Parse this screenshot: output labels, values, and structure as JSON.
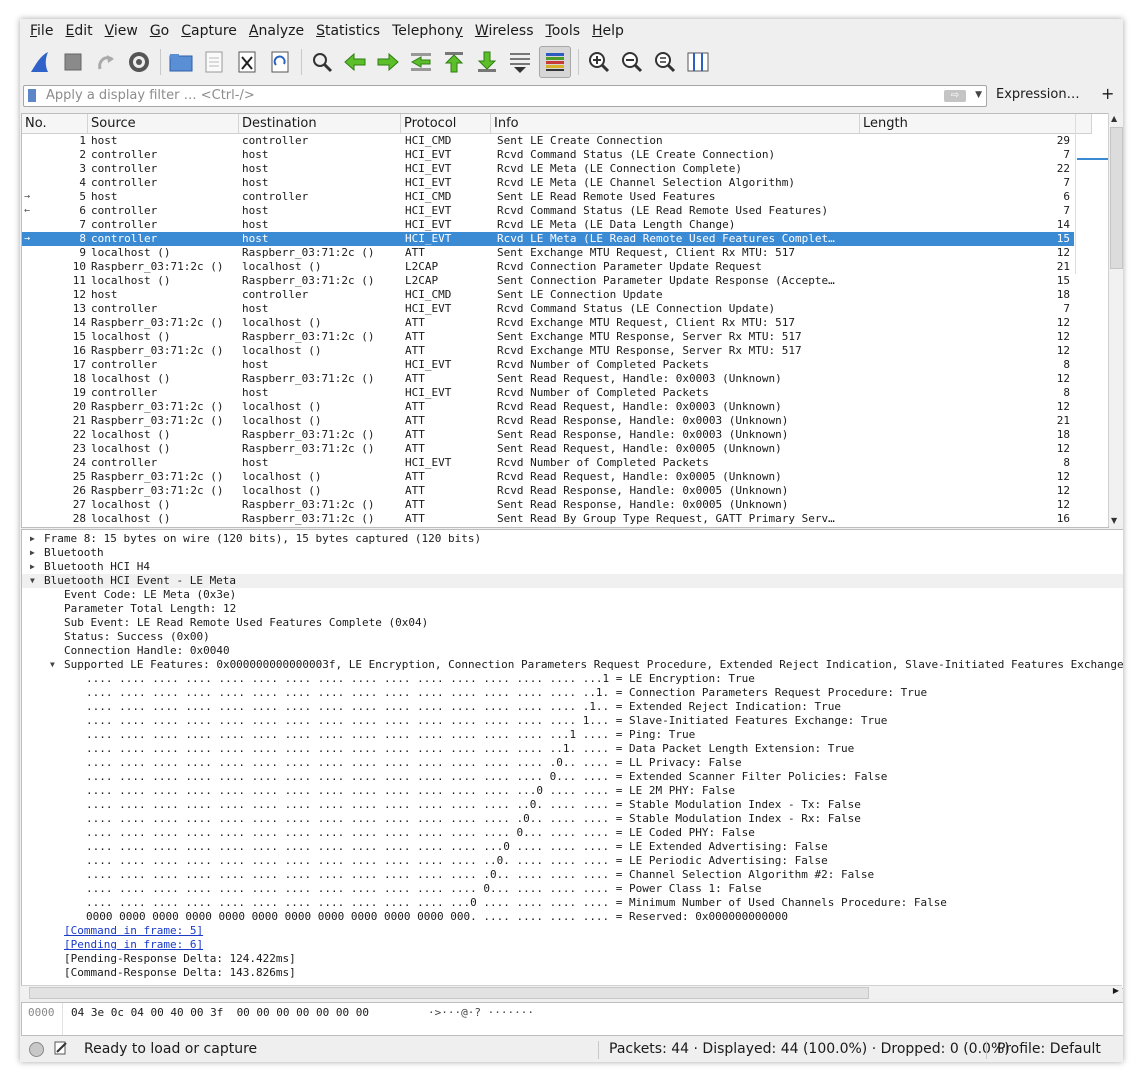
{
  "menu": [
    {
      "u": "F",
      "rest": "ile"
    },
    {
      "u": "E",
      "rest": "dit"
    },
    {
      "u": "V",
      "rest": "iew"
    },
    {
      "u": "G",
      "rest": "o"
    },
    {
      "u": "C",
      "rest": "apture"
    },
    {
      "u": "A",
      "rest": "nalyze"
    },
    {
      "u": "S",
      "rest": "tatistics"
    },
    {
      "u": "",
      "rest": "Telephony",
      "pre": "Telephon",
      "post": "y"
    },
    {
      "u": "W",
      "rest": "ireless"
    },
    {
      "u": "T",
      "rest": "ools"
    },
    {
      "u": "H",
      "rest": "elp"
    }
  ],
  "toolbar_icons": [
    "shark-fin-icon",
    "stop-icon",
    "restart-icon",
    "capture-options-icon",
    "open-folder-icon",
    "file-set-icon",
    "close-file-icon",
    "reload-icon",
    "find-icon",
    "go-back-icon",
    "go-forward-icon",
    "go-to-packet-icon",
    "first-packet-icon",
    "last-packet-icon",
    "autoscroll-icon",
    "colorize-icon",
    "zoom-in-icon",
    "zoom-out-icon",
    "zoom-normal-icon",
    "resize-columns-icon"
  ],
  "filter": {
    "placeholder": "Apply a display filter … <Ctrl-/>",
    "expression_label": "Expression…",
    "plus_label": "+"
  },
  "columns": {
    "no": "No.",
    "source": "Source",
    "destination": "Destination",
    "protocol": "Protocol",
    "info": "Info",
    "length": "Length"
  },
  "packets": [
    {
      "no": "1",
      "src": "host",
      "dst": "controller",
      "proto": "HCI_CMD",
      "info": "Sent LE Create Connection",
      "len": "29",
      "mark": ""
    },
    {
      "no": "2",
      "src": "controller",
      "dst": "host",
      "proto": "HCI_EVT",
      "info": "Rcvd Command Status (LE Create Connection)",
      "len": "7",
      "mark": ""
    },
    {
      "no": "3",
      "src": "controller",
      "dst": "host",
      "proto": "HCI_EVT",
      "info": "Rcvd LE Meta (LE Connection Complete)",
      "len": "22",
      "mark": ""
    },
    {
      "no": "4",
      "src": "controller",
      "dst": "host",
      "proto": "HCI_EVT",
      "info": "Rcvd LE Meta (LE Channel Selection Algorithm)",
      "len": "7",
      "mark": ""
    },
    {
      "no": "5",
      "src": "host",
      "dst": "controller",
      "proto": "HCI_CMD",
      "info": "Sent LE Read Remote Used Features",
      "len": "6",
      "mark": "→"
    },
    {
      "no": "6",
      "src": "controller",
      "dst": "host",
      "proto": "HCI_EVT",
      "info": "Rcvd Command Status (LE Read Remote Used Features)",
      "len": "7",
      "mark": "←"
    },
    {
      "no": "7",
      "src": "controller",
      "dst": "host",
      "proto": "HCI_EVT",
      "info": "Rcvd LE Meta (LE Data Length Change)",
      "len": "14",
      "mark": ""
    },
    {
      "no": "8",
      "src": "controller",
      "dst": "host",
      "proto": "HCI_EVT",
      "info": "Rcvd LE Meta (LE Read Remote Used Features Complet…",
      "len": "15",
      "mark": "→"
    },
    {
      "no": "9",
      "src": "localhost ()",
      "dst": "Raspberr_03:71:2c ()",
      "proto": "ATT",
      "info": "Sent Exchange MTU Request, Client Rx MTU: 517",
      "len": "12",
      "mark": ""
    },
    {
      "no": "10",
      "src": "Raspberr_03:71:2c ()",
      "dst": "localhost ()",
      "proto": "L2CAP",
      "info": "Rcvd Connection Parameter Update Request",
      "len": "21",
      "mark": ""
    },
    {
      "no": "11",
      "src": "localhost ()",
      "dst": "Raspberr_03:71:2c ()",
      "proto": "L2CAP",
      "info": "Sent Connection Parameter Update Response (Accepte…",
      "len": "15",
      "mark": ""
    },
    {
      "no": "12",
      "src": "host",
      "dst": "controller",
      "proto": "HCI_CMD",
      "info": "Sent LE Connection Update",
      "len": "18",
      "mark": ""
    },
    {
      "no": "13",
      "src": "controller",
      "dst": "host",
      "proto": "HCI_EVT",
      "info": "Rcvd Command Status (LE Connection Update)",
      "len": "7",
      "mark": ""
    },
    {
      "no": "14",
      "src": "Raspberr_03:71:2c ()",
      "dst": "localhost ()",
      "proto": "ATT",
      "info": "Rcvd Exchange MTU Request, Client Rx MTU: 517",
      "len": "12",
      "mark": ""
    },
    {
      "no": "15",
      "src": "localhost ()",
      "dst": "Raspberr_03:71:2c ()",
      "proto": "ATT",
      "info": "Sent Exchange MTU Response, Server Rx MTU: 517",
      "len": "12",
      "mark": ""
    },
    {
      "no": "16",
      "src": "Raspberr_03:71:2c ()",
      "dst": "localhost ()",
      "proto": "ATT",
      "info": "Rcvd Exchange MTU Response, Server Rx MTU: 517",
      "len": "12",
      "mark": ""
    },
    {
      "no": "17",
      "src": "controller",
      "dst": "host",
      "proto": "HCI_EVT",
      "info": "Rcvd Number of Completed Packets",
      "len": "8",
      "mark": ""
    },
    {
      "no": "18",
      "src": "localhost ()",
      "dst": "Raspberr_03:71:2c ()",
      "proto": "ATT",
      "info": "Sent Read Request, Handle: 0x0003 (Unknown)",
      "len": "12",
      "mark": ""
    },
    {
      "no": "19",
      "src": "controller",
      "dst": "host",
      "proto": "HCI_EVT",
      "info": "Rcvd Number of Completed Packets",
      "len": "8",
      "mark": ""
    },
    {
      "no": "20",
      "src": "Raspberr_03:71:2c ()",
      "dst": "localhost ()",
      "proto": "ATT",
      "info": "Rcvd Read Request, Handle: 0x0003 (Unknown)",
      "len": "12",
      "mark": ""
    },
    {
      "no": "21",
      "src": "Raspberr_03:71:2c ()",
      "dst": "localhost ()",
      "proto": "ATT",
      "info": "Rcvd Read Response, Handle: 0x0003 (Unknown)",
      "len": "21",
      "mark": ""
    },
    {
      "no": "22",
      "src": "localhost ()",
      "dst": "Raspberr_03:71:2c ()",
      "proto": "ATT",
      "info": "Sent Read Response, Handle: 0x0003 (Unknown)",
      "len": "18",
      "mark": ""
    },
    {
      "no": "23",
      "src": "localhost ()",
      "dst": "Raspberr_03:71:2c ()",
      "proto": "ATT",
      "info": "Sent Read Request, Handle: 0x0005 (Unknown)",
      "len": "12",
      "mark": ""
    },
    {
      "no": "24",
      "src": "controller",
      "dst": "host",
      "proto": "HCI_EVT",
      "info": "Rcvd Number of Completed Packets",
      "len": "8",
      "mark": ""
    },
    {
      "no": "25",
      "src": "Raspberr_03:71:2c ()",
      "dst": "localhost ()",
      "proto": "ATT",
      "info": "Rcvd Read Request, Handle: 0x0005 (Unknown)",
      "len": "12",
      "mark": ""
    },
    {
      "no": "26",
      "src": "Raspberr_03:71:2c ()",
      "dst": "localhost ()",
      "proto": "ATT",
      "info": "Rcvd Read Response, Handle: 0x0005 (Unknown)",
      "len": "12",
      "mark": ""
    },
    {
      "no": "27",
      "src": "localhost ()",
      "dst": "Raspberr_03:71:2c ()",
      "proto": "ATT",
      "info": "Sent Read Response, Handle: 0x0005 (Unknown)",
      "len": "12",
      "mark": ""
    },
    {
      "no": "28",
      "src": "localhost ()",
      "dst": "Raspberr_03:71:2c ()",
      "proto": "ATT",
      "info": "Sent Read By Group Type Request, GATT Primary Serv…",
      "len": "16",
      "mark": ""
    }
  ],
  "selected_packet": "8",
  "details": [
    {
      "lvl": 0,
      "exp": "closed",
      "text": "Frame 8: 15 bytes on wire (120 bits), 15 bytes captured (120 bits)"
    },
    {
      "lvl": 0,
      "exp": "closed",
      "text": "Bluetooth"
    },
    {
      "lvl": 0,
      "exp": "closed",
      "text": "Bluetooth HCI H4"
    },
    {
      "lvl": 0,
      "exp": "open",
      "text": "Bluetooth HCI Event - LE Meta",
      "hl": true
    },
    {
      "lvl": 1,
      "exp": "",
      "text": "Event Code: LE Meta (0x3e)"
    },
    {
      "lvl": 1,
      "exp": "",
      "text": "Parameter Total Length: 12"
    },
    {
      "lvl": 1,
      "exp": "",
      "text": "Sub Event: LE Read Remote Used Features Complete (0x04)"
    },
    {
      "lvl": 1,
      "exp": "",
      "text": "Status: Success (0x00)"
    },
    {
      "lvl": 1,
      "exp": "",
      "text": "Connection Handle: 0x0040"
    },
    {
      "lvl": 1,
      "exp": "open",
      "text": "Supported LE Features: 0x000000000000003f, LE Encryption, Connection Parameters Request Procedure, Extended Reject Indication, Slave-Initiated Features Exchange, Ping, Data Packet Length Extension"
    },
    {
      "lvl": 2,
      "exp": "",
      "text": ".... .... .... .... .... .... .... .... .... .... .... .... .... .... .... ...1 = LE Encryption: True"
    },
    {
      "lvl": 2,
      "exp": "",
      "text": ".... .... .... .... .... .... .... .... .... .... .... .... .... .... .... ..1. = Connection Parameters Request Procedure: True"
    },
    {
      "lvl": 2,
      "exp": "",
      "text": ".... .... .... .... .... .... .... .... .... .... .... .... .... .... .... .1.. = Extended Reject Indication: True"
    },
    {
      "lvl": 2,
      "exp": "",
      "text": ".... .... .... .... .... .... .... .... .... .... .... .... .... .... .... 1... = Slave-Initiated Features Exchange: True"
    },
    {
      "lvl": 2,
      "exp": "",
      "text": ".... .... .... .... .... .... .... .... .... .... .... .... .... .... ...1 .... = Ping: True"
    },
    {
      "lvl": 2,
      "exp": "",
      "text": ".... .... .... .... .... .... .... .... .... .... .... .... .... .... ..1. .... = Data Packet Length Extension: True"
    },
    {
      "lvl": 2,
      "exp": "",
      "text": ".... .... .... .... .... .... .... .... .... .... .... .... .... .... .0.. .... = LL Privacy: False"
    },
    {
      "lvl": 2,
      "exp": "",
      "text": ".... .... .... .... .... .... .... .... .... .... .... .... .... .... 0... .... = Extended Scanner Filter Policies: False"
    },
    {
      "lvl": 2,
      "exp": "",
      "text": ".... .... .... .... .... .... .... .... .... .... .... .... .... ...0 .... .... = LE 2M PHY: False"
    },
    {
      "lvl": 2,
      "exp": "",
      "text": ".... .... .... .... .... .... .... .... .... .... .... .... .... ..0. .... .... = Stable Modulation Index - Tx: False"
    },
    {
      "lvl": 2,
      "exp": "",
      "text": ".... .... .... .... .... .... .... .... .... .... .... .... .... .0.. .... .... = Stable Modulation Index - Rx: False"
    },
    {
      "lvl": 2,
      "exp": "",
      "text": ".... .... .... .... .... .... .... .... .... .... .... .... .... 0... .... .... = LE Coded PHY: False"
    },
    {
      "lvl": 2,
      "exp": "",
      "text": ".... .... .... .... .... .... .... .... .... .... .... .... ...0 .... .... .... = LE Extended Advertising: False"
    },
    {
      "lvl": 2,
      "exp": "",
      "text": ".... .... .... .... .... .... .... .... .... .... .... .... ..0. .... .... .... = LE Periodic Advertising: False"
    },
    {
      "lvl": 2,
      "exp": "",
      "text": ".... .... .... .... .... .... .... .... .... .... .... .... .0.. .... .... .... = Channel Selection Algorithm #2: False"
    },
    {
      "lvl": 2,
      "exp": "",
      "text": ".... .... .... .... .... .... .... .... .... .... .... .... 0... .... .... .... = Power Class 1: False"
    },
    {
      "lvl": 2,
      "exp": "",
      "text": ".... .... .... .... .... .... .... .... .... .... .... ...0 .... .... .... .... = Minimum Number of Used Channels Procedure: False"
    },
    {
      "lvl": 2,
      "exp": "",
      "text": "0000 0000 0000 0000 0000 0000 0000 0000 0000 0000 0000 000. .... .... .... .... = Reserved: 0x000000000000"
    },
    {
      "lvl": 1,
      "exp": "",
      "text": "[Command in frame: 5]",
      "link": true
    },
    {
      "lvl": 1,
      "exp": "",
      "text": "[Pending in frame: 6]",
      "link": true
    },
    {
      "lvl": 1,
      "exp": "",
      "text": "[Pending-Response Delta: 124.422ms]"
    },
    {
      "lvl": 1,
      "exp": "",
      "text": "[Command-Response Delta: 143.826ms]"
    }
  ],
  "bytes": {
    "offset": "0000",
    "hex": "04 3e 0c 04 00 40 00 3f  00 00 00 00 00 00 00",
    "ascii": "·>···@·? ·······"
  },
  "status": {
    "ready": "Ready to load or capture",
    "packets": "Packets: 44 · Displayed: 44 (100.0%) · Dropped: 0 (0.0%)",
    "profile": "Profile: Default"
  },
  "colors": {
    "selection": "#3a8ad4",
    "link": "#1a3bc9"
  }
}
